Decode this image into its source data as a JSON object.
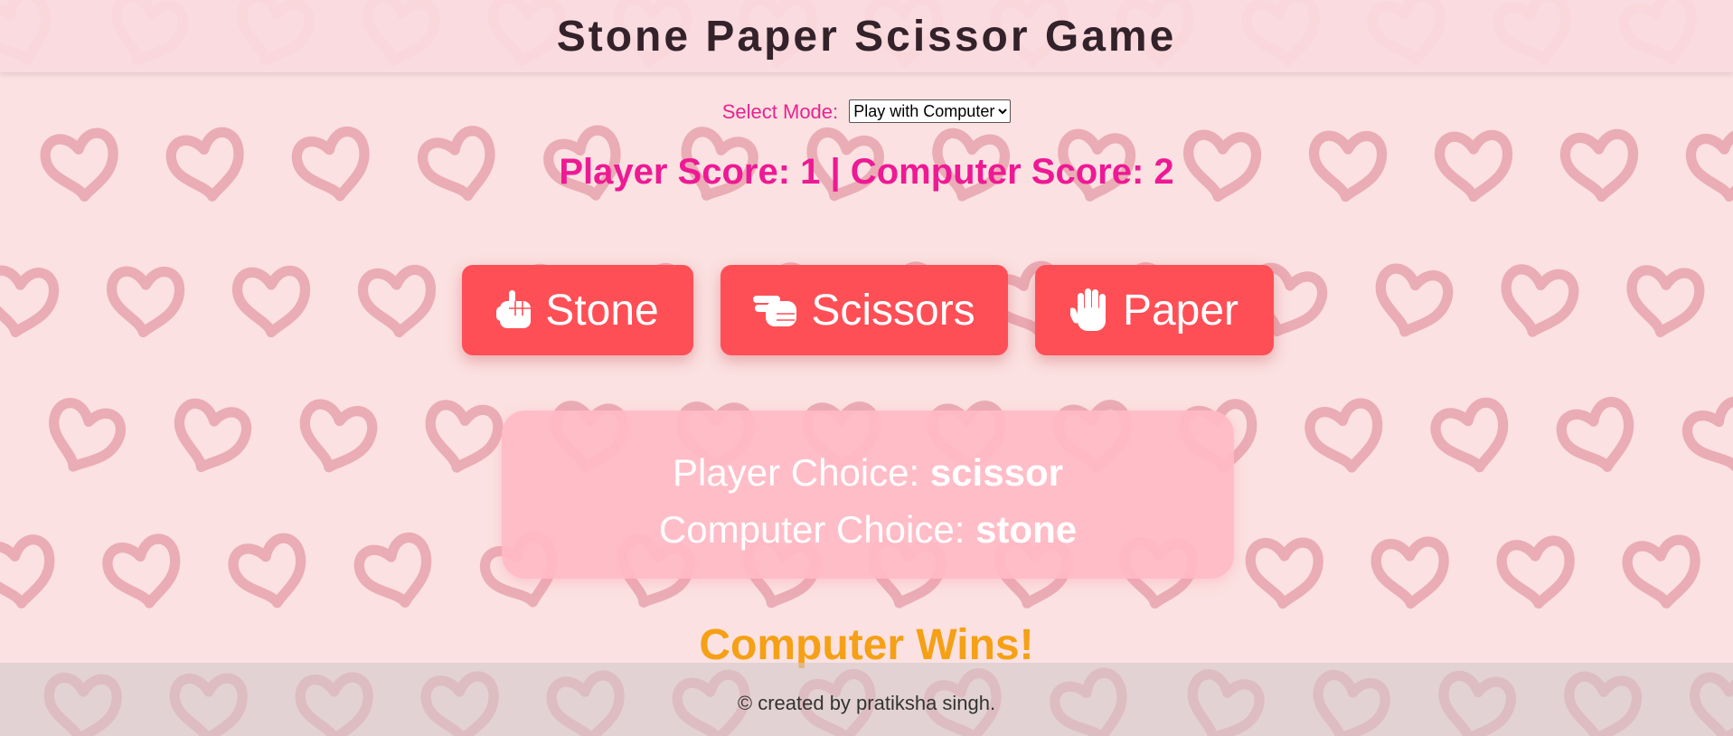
{
  "header": {
    "title": "Stone Paper Scissor Game"
  },
  "mode": {
    "label": "Select Mode:",
    "selected": "Play with Computer"
  },
  "score": {
    "text": "Player Score: 1 | Computer Score: 2"
  },
  "buttons": {
    "stone": {
      "label": "Stone",
      "icon": "fist-icon"
    },
    "scissors": {
      "label": "Scissors",
      "icon": "scissors-hand-icon"
    },
    "paper": {
      "label": "Paper",
      "icon": "open-hand-icon"
    }
  },
  "result": {
    "player_label": "Player Choice:",
    "player_value": "scissor",
    "computer_label": "Computer Choice:",
    "computer_value": "stone"
  },
  "winner": {
    "text": "Computer Wins!"
  },
  "footer": {
    "text": "© created by pratiksha singh."
  },
  "colors": {
    "accent": "#ff4f56",
    "score": "#ee1994",
    "winner": "#f5a015",
    "background": "#fbe1e1",
    "heart": "#e49aa6"
  }
}
